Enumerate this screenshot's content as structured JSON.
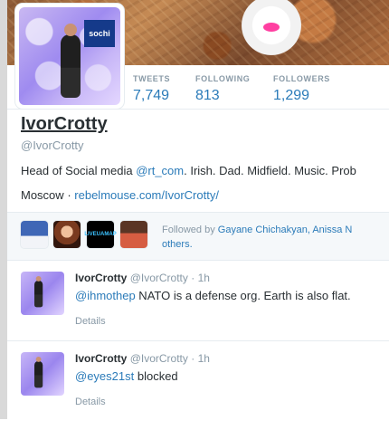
{
  "profile": {
    "name": "IvorCrotty",
    "handle": "@IvorCrotty",
    "bio_parts": [
      "Head of Social media ",
      "@rt_com",
      ". Irish. Dad. Midfield. Music. Prob"
    ],
    "location": "Moscow",
    "website": "rebelmouse.com/IvorCrotty/",
    "stats": [
      {
        "label": "TWEETS",
        "value": "7,749"
      },
      {
        "label": "FOLLOWING",
        "value": "813"
      },
      {
        "label": "FOLLOWERS",
        "value": "1,299"
      }
    ]
  },
  "avatar": {
    "sign_text": "sochi"
  },
  "followed": {
    "text_prefix": "Followed by ",
    "names": "Gayane Chichakyan, Anissa N",
    "text_suffix": "others.",
    "thumb_3_text": "LIVEUAMAP"
  },
  "tweets": [
    {
      "name": "IvorCrotty",
      "handle": "@IvorCrotty",
      "time": "· 1h",
      "mention": "@ihmothep",
      "text": " NATO is a defense org. Earth is also flat.",
      "details": "Details"
    },
    {
      "name": "IvorCrotty",
      "handle": "@IvorCrotty",
      "time": "· 1h",
      "mention": "@eyes21st",
      "text": " blocked",
      "details": "Details"
    }
  ],
  "colors": {
    "link": "#2b7bb9",
    "muted": "#8899a6",
    "text": "#292f33"
  }
}
